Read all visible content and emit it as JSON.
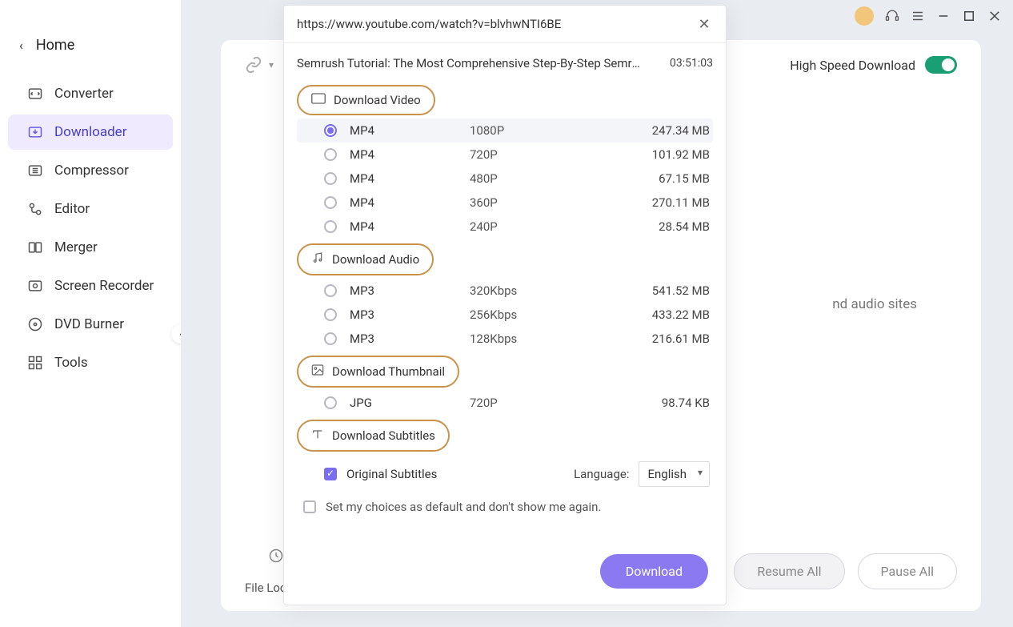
{
  "sidebar": {
    "home": "Home",
    "items": [
      {
        "label": "Converter",
        "icon": "converter"
      },
      {
        "label": "Downloader",
        "icon": "downloader",
        "active": true
      },
      {
        "label": "Compressor",
        "icon": "compressor"
      },
      {
        "label": "Editor",
        "icon": "editor"
      },
      {
        "label": "Merger",
        "icon": "merger"
      },
      {
        "label": "Screen Recorder",
        "icon": "screen-recorder"
      },
      {
        "label": "DVD Burner",
        "icon": "dvd-burner"
      },
      {
        "label": "Tools",
        "icon": "tools"
      }
    ]
  },
  "header": {
    "high_speed_label": "High Speed Download",
    "high_speed_on": true
  },
  "background_hint": "nd audio sites",
  "footer": {
    "file_location": "File Locatio",
    "resume": "Resume All",
    "pause": "Pause All"
  },
  "modal": {
    "url": "https://www.youtube.com/watch?v=blvhwNTI6BE",
    "title": "Semrush Tutorial: The Most Comprehensive Step-By-Step Semrush Tut...",
    "duration": "03:51:03",
    "sections": {
      "video": {
        "label": "Download Video",
        "options": [
          {
            "format": "MP4",
            "quality": "1080P",
            "size": "247.34 MB",
            "selected": true
          },
          {
            "format": "MP4",
            "quality": "720P",
            "size": "101.92 MB"
          },
          {
            "format": "MP4",
            "quality": "480P",
            "size": "67.15 MB"
          },
          {
            "format": "MP4",
            "quality": "360P",
            "size": "270.11 MB"
          },
          {
            "format": "MP4",
            "quality": "240P",
            "size": "28.54 MB"
          }
        ]
      },
      "audio": {
        "label": "Download Audio",
        "options": [
          {
            "format": "MP3",
            "quality": "320Kbps",
            "size": "541.52 MB"
          },
          {
            "format": "MP3",
            "quality": "256Kbps",
            "size": "433.22 MB"
          },
          {
            "format": "MP3",
            "quality": "128Kbps",
            "size": "216.61 MB"
          }
        ]
      },
      "thumbnail": {
        "label": "Download Thumbnail",
        "options": [
          {
            "format": "JPG",
            "quality": "720P",
            "size": "98.74 KB"
          }
        ]
      },
      "subtitles": {
        "label": "Download Subtitles",
        "original_label": "Original Subtitles",
        "original_checked": true,
        "language_label": "Language:",
        "language_value": "English"
      }
    },
    "default_label": "Set my choices as default and don't show me again.",
    "default_checked": false,
    "download_btn": "Download"
  }
}
